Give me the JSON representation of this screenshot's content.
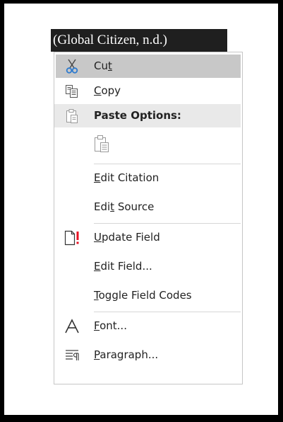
{
  "citation": {
    "text": "(Global Citizen, n.d.)"
  },
  "menu": {
    "cut": {
      "pre": "Cu",
      "key": "t",
      "post": ""
    },
    "copy": {
      "pre": "",
      "key": "C",
      "post": "opy"
    },
    "paste_header": {
      "label": "Paste Options:"
    },
    "edit_citation": {
      "pre": "",
      "key": "E",
      "post": "dit Citation"
    },
    "edit_source": {
      "pre": "Edi",
      "key": "t",
      "post": " Source"
    },
    "update_field": {
      "pre": "",
      "key": "U",
      "post": "pdate Field"
    },
    "edit_field": {
      "pre": "",
      "key": "E",
      "post": "dit Field..."
    },
    "toggle_codes": {
      "pre": "",
      "key": "T",
      "post": "oggle Field Codes"
    },
    "font": {
      "pre": "",
      "key": "F",
      "post": "ont..."
    },
    "paragraph": {
      "pre": "",
      "key": "P",
      "post": "aragraph..."
    }
  },
  "colors": {
    "highlight": "#c8c8c8",
    "header_bg": "#e9e9e9",
    "scissors_blue": "#2e7bcf",
    "alert_red": "#e81123"
  },
  "icons": [
    "scissors-icon",
    "copy-icon",
    "paste-icon",
    "paste-keep-text-icon",
    "update-field-icon",
    "font-icon",
    "paragraph-icon"
  ]
}
